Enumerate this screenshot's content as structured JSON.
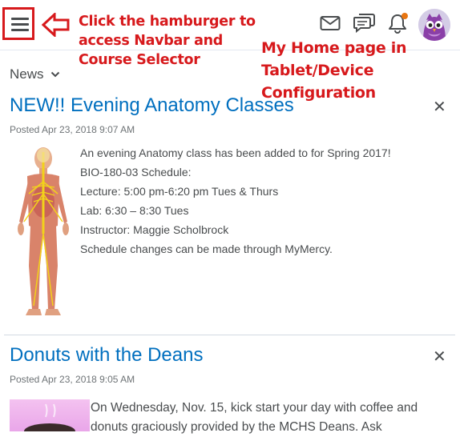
{
  "annotations": {
    "hamburger_note": "Click the hamburger to access Navbar and Course Selector",
    "page_note": "My Home page in Tablet/Device Configuration"
  },
  "topbar": {
    "icons": [
      "hamburger-icon",
      "email-icon",
      "chat-icon",
      "bell-icon",
      "avatar"
    ],
    "notification_color": "#e87511"
  },
  "widget": {
    "title": "News"
  },
  "news": [
    {
      "title": "NEW!! Evening Anatomy Classes",
      "posted": "Posted Apr 23, 2018 9:07 AM",
      "lines": [
        "An evening Anatomy class has been added to for Spring 2017!",
        "BIO-180-03 Schedule:",
        "Lecture: 5:00 pm-6:20 pm Tues & Thurs",
        "Lab: 6:30 – 8:30   Tues",
        "Instructor: Maggie Scholbrock",
        "Schedule changes can be made through MyMercy."
      ]
    },
    {
      "title": "Donuts with the Deans",
      "posted": "Posted Apr 23, 2018 9:05 AM",
      "body": "On Wednesday, Nov. 15, kick start your day with coffee and donuts graciously provided by the MCHS Deans. Ask"
    }
  ],
  "colors": {
    "link": "#006fbf",
    "annotation": "#d7191c"
  }
}
